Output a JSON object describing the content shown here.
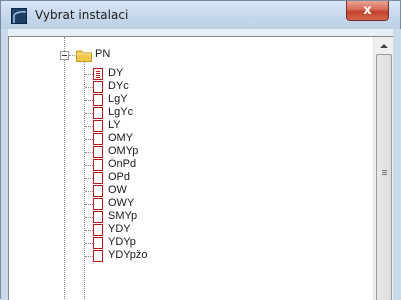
{
  "window": {
    "title": "Vybrat instalaci",
    "close_label": "x"
  },
  "tree": {
    "root": {
      "label": "PN"
    },
    "items": [
      {
        "label": "DY",
        "selected": true
      },
      {
        "label": "DYc"
      },
      {
        "label": "LgY"
      },
      {
        "label": "LgYc"
      },
      {
        "label": "LY"
      },
      {
        "label": "OMY"
      },
      {
        "label": "OMYp"
      },
      {
        "label": "OnPd"
      },
      {
        "label": "OPd"
      },
      {
        "label": "OW"
      },
      {
        "label": "OWY"
      },
      {
        "label": "SMYp"
      },
      {
        "label": "YDY"
      },
      {
        "label": "YDYp"
      },
      {
        "label": "YDYpžo"
      }
    ]
  },
  "colors": {
    "title_bar": "#c6d8ec",
    "close_button": "#c2412a",
    "doc_icon": "#b31c1c",
    "folder_icon": "#f2c94c"
  }
}
